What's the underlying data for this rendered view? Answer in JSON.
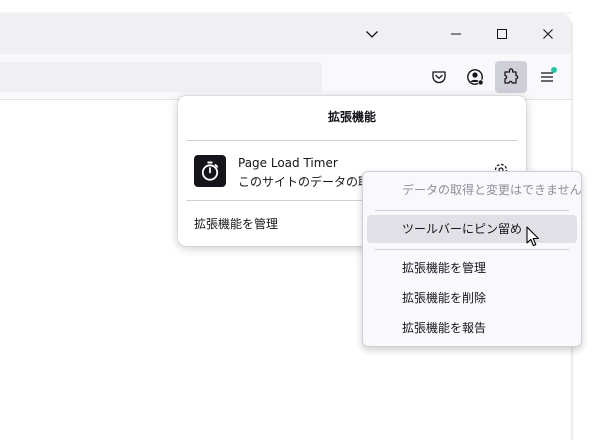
{
  "window": {
    "controls": {
      "list_tabs_icon": "chevron-down-icon",
      "minimize_icon": "minimize-icon",
      "maximize_icon": "maximize-icon",
      "close_icon": "close-icon"
    }
  },
  "toolbar": {
    "pocket_icon": "pocket-icon",
    "account_icon": "account-icon",
    "extensions_icon": "puzzle-icon",
    "menu_icon": "hamburger-menu-icon",
    "menu_badge_color": "#2ac3a2"
  },
  "extensions_panel": {
    "title": "拡張機能",
    "extension": {
      "name": "Page Load Timer",
      "description": "このサイトのデータの取得と変更はできません",
      "icon": "stopwatch-icon"
    },
    "manage_label": "拡張機能を管理"
  },
  "context_menu": {
    "items": [
      {
        "label": "データの取得と変更はできません",
        "disabled": true
      },
      {
        "label": "ツールバーにピン留め",
        "hover": true
      },
      {
        "label": "拡張機能を管理"
      },
      {
        "label": "拡張機能を削除"
      },
      {
        "label": "拡張機能を報告"
      }
    ]
  },
  "cursor": "arrow-cursor"
}
